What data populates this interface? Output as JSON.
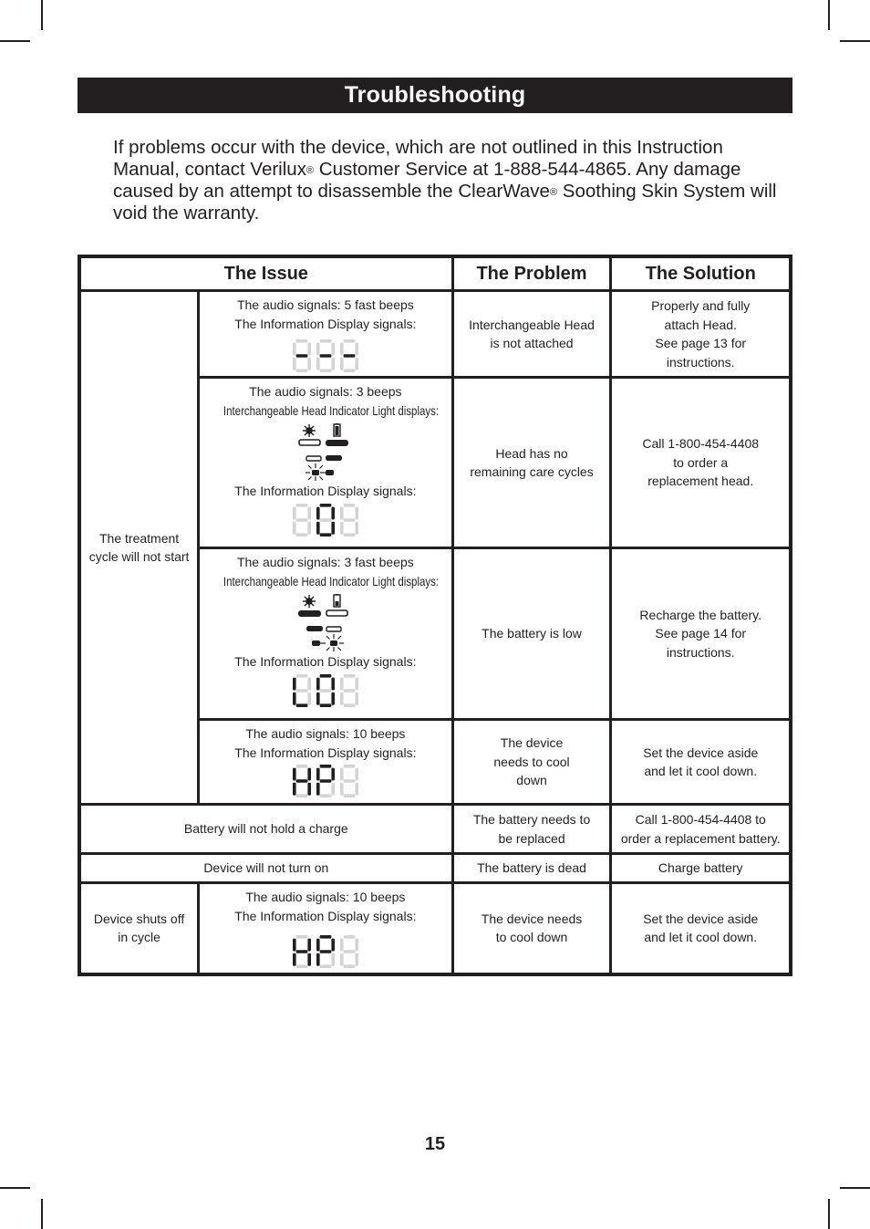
{
  "page": {
    "title": "Troubleshooting",
    "intro_parts": [
      "If problems occur with the device, which are not outlined in this Instruction Manual, contact Verilux",
      "®",
      " Customer Service at 1-888-544-4865. Any damage caused by an attempt to disassemble the ClearWave",
      "®",
      " Soothing Skin System will void the warranty."
    ],
    "page_number": "15"
  },
  "table": {
    "headers": {
      "issue": "The Issue",
      "problem": "The Problem",
      "solution": "The Solution"
    },
    "group1": {
      "issue": "The treatment cycle will not start",
      "rows": [
        {
          "audio": "The audio signals: 5 fast beeps",
          "display_label": "The Information Display signals:",
          "display": "---",
          "problem": "Interchangeable Head is not attached",
          "solution_lines": [
            "Properly and fully",
            "attach Head.",
            "See page 13 for",
            "instructions."
          ]
        },
        {
          "audio": "The audio signals: 3 beeps",
          "indicator_label": "Interchangeable Head Indicator Light displays:",
          "display_label": "The Information Display signals:",
          "display": "0",
          "problem": "Head has no remaining care cycles",
          "solution_lines": [
            "Call 1-800-454-4408",
            "to order a",
            "replacement head."
          ]
        },
        {
          "audio": "The audio signals: 3 fast beeps",
          "indicator_label": "Interchangeable Head Indicator Light displays:",
          "display_label": "The Information Display signals:",
          "display": "LO",
          "problem": "The battery is low",
          "solution_lines": [
            "Recharge the battery.",
            "See page 14 for",
            "instructions."
          ]
        },
        {
          "audio": "The audio signals: 10 beeps",
          "display_label": "The Information Display signals:",
          "display": "HP",
          "problem": "The device needs to cool down",
          "solution_lines": [
            "Set the device aside",
            "and let it cool down."
          ]
        }
      ]
    },
    "row_battery_hold": {
      "issue": "Battery will not hold a charge",
      "problem_lines": [
        "The battery needs to",
        "be replaced"
      ],
      "solution_lines": [
        "Call 1-800-454-4408 to",
        "order a replacement battery."
      ]
    },
    "row_no_turn_on": {
      "issue": "Device will not turn on",
      "problem": "The battery is dead",
      "solution": "Charge battery"
    },
    "row_shuts_off": {
      "issue_lines": [
        "Device shuts off",
        "in cycle"
      ],
      "audio": "The audio signals: 10 beeps",
      "display_label": "The Information Display signals:",
      "display": "HP",
      "problem_lines": [
        "The device needs",
        "to cool down"
      ],
      "solution_lines": [
        "Set the device aside",
        "and let it cool down."
      ]
    }
  }
}
